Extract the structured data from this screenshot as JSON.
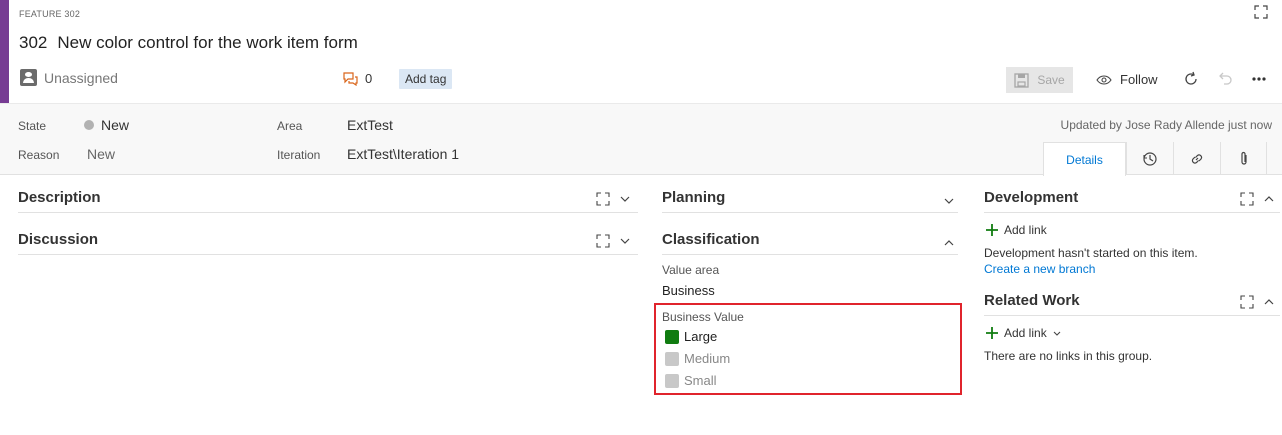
{
  "header": {
    "type_label": "FEATURE 302",
    "id": "302",
    "title": "New color control for the work item form",
    "assignee": "Unassigned",
    "comment_count": "0",
    "add_tag_label": "Add tag",
    "save_label": "Save",
    "follow_label": "Follow",
    "accent_color": "#773b93"
  },
  "info": {
    "state_label": "State",
    "state_value": "New",
    "reason_label": "Reason",
    "reason_value": "New",
    "area_label": "Area",
    "area_value": "ExtTest",
    "iteration_label": "Iteration",
    "iteration_value": "ExtTest\\Iteration 1",
    "updated_text": "Updated by Jose Rady Allende just now"
  },
  "tabs": {
    "details_label": "Details",
    "icons": [
      "history-icon",
      "link-icon",
      "attachment-icon"
    ]
  },
  "left_column": {
    "description_title": "Description",
    "discussion_title": "Discussion"
  },
  "middle_column": {
    "planning_title": "Planning",
    "classification_title": "Classification",
    "value_area_label": "Value area",
    "value_area_value": "Business",
    "business_value_label": "Business Value",
    "business_value_options": [
      {
        "label": "Large",
        "color": "#107c10",
        "selected": true
      },
      {
        "label": "Medium",
        "color": "#c8c8c8",
        "selected": false
      },
      {
        "label": "Small",
        "color": "#c8c8c8",
        "selected": false
      }
    ],
    "highlight_color": "#e0242c"
  },
  "right_column": {
    "development_title": "Development",
    "dev_add_link": "Add link",
    "dev_empty_text": "Development hasn't started on this item.",
    "create_branch_link": "Create a new branch",
    "related_title": "Related Work",
    "related_add_link": "Add link",
    "related_empty_text": "There are no links in this group."
  }
}
